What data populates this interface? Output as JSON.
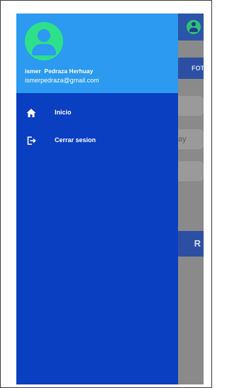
{
  "underlay": {
    "photo_button_label": "FOTO",
    "field_partial_text": "ay",
    "save_button_partial_label": "R"
  },
  "drawer": {
    "header": {
      "user_name": "ismer  Pedraza Herhuay",
      "user_email": "ismerpedraza@gmail.com"
    },
    "items": [
      {
        "label": "Inicio",
        "icon": "home-icon"
      },
      {
        "label": "Cerrar sesion",
        "icon": "logout-icon"
      }
    ]
  },
  "colors": {
    "drawer_bg": "#0a3fc2",
    "header_bg": "#2b9af0",
    "avatar": "#2fe08a",
    "scrim": "#8a8a8a"
  }
}
